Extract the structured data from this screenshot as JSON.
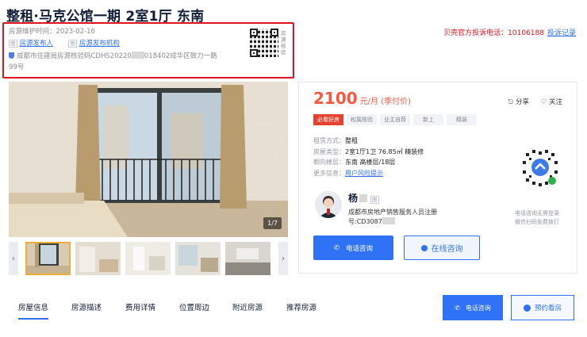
{
  "title": "整租·马克公馆一期 2室1厅 东南",
  "verify": {
    "maintain_label": "房源维护时间：",
    "maintain_date": "2023-02-16",
    "source_entry_tag": "图",
    "source_entry": "房源发布人",
    "source_org_tag": "图",
    "source_org": "房源发布机构",
    "code_prefix": "成都市住建局房源核验码CDHS20220",
    "code_suffix": "018402成华区致力一路",
    "code_line2": "99号",
    "qr_caption": "房源核验"
  },
  "complaint": {
    "label": "贝壳官方投诉电话：10106188",
    "link": "投诉记录"
  },
  "gallery": {
    "counter": "1/7",
    "prev_arrow": "‹",
    "next_arrow": "›"
  },
  "price": {
    "amount": "2100",
    "unit": "元/月 (季付价)"
  },
  "actions": {
    "share": "分享",
    "follow": "关注"
  },
  "tags": [
    "必看好房",
    "权属核验",
    "业主自荐",
    "新上",
    "精装"
  ],
  "attrs": [
    {
      "label": "租赁方式：",
      "value": "整租"
    },
    {
      "label": "房屋类型：",
      "value": "2室1厅1卫 76.85㎡ 精装修"
    },
    {
      "label": "朝向楼层：",
      "value": "东南 高楼层/18层"
    },
    {
      "label": "更多信息：",
      "value": "用户风险提示"
    }
  ],
  "agent": {
    "name": "杨",
    "cert_line1": "成都市房地产销售服务人员注册",
    "cert_line2": "号:CD3087"
  },
  "buttons": {
    "call": "电话咨询",
    "chat": "在线咨询",
    "call2": "电话咨询",
    "book": "预约看房"
  },
  "qr_caption": {
    "line1": "电话咨询无需登录",
    "line2": "微信扫码免费拨打"
  },
  "tabs": [
    "房屋信息",
    "房源描述",
    "费用详情",
    "位置周边",
    "附近房源",
    "推荐房源"
  ],
  "colors": {
    "accent_blue": "#3072f6",
    "price_red": "#fa5741",
    "highlight_red": "#e0141e"
  }
}
